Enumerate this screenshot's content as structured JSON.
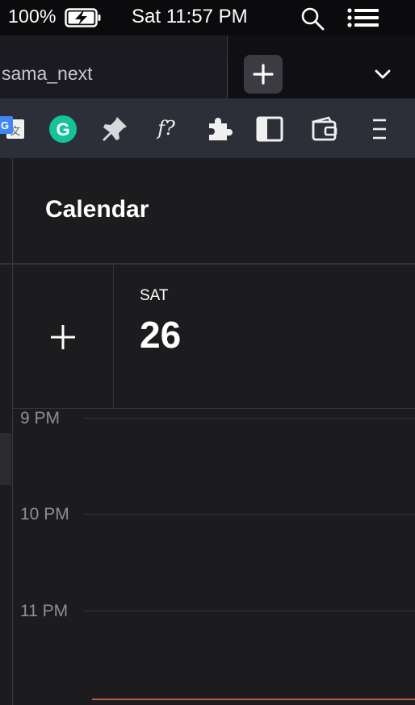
{
  "menubar": {
    "battery_percent": "100%",
    "clock": "Sat 11:57 PM",
    "icons": [
      "battery-charging-icon",
      "search-icon",
      "control-center-icon"
    ]
  },
  "browser": {
    "active_tab_title": "sama_next",
    "new_tab_icon": "plus-icon",
    "tab_list_icon": "chevron-down-icon",
    "extensions": [
      "google-translate-icon",
      "grammarly-icon",
      "pin-icon",
      "formula-icon",
      "puzzle-piece-icon",
      "sidebar-icon",
      "wallet-icon",
      "menu-icon"
    ],
    "formula_glyph": "f?",
    "grammarly_glyph": "G",
    "translate_glyph": "G"
  },
  "calendar": {
    "title": "Calendar",
    "add_icon": "plus-icon",
    "day_name": "SAT",
    "day_number": "26",
    "hours": [
      "9 PM",
      "10 PM",
      "11 PM"
    ],
    "colors": {
      "background": "#1c1c1e",
      "now_indicator": "#b85c52",
      "grammarly": "#15c39a"
    }
  }
}
